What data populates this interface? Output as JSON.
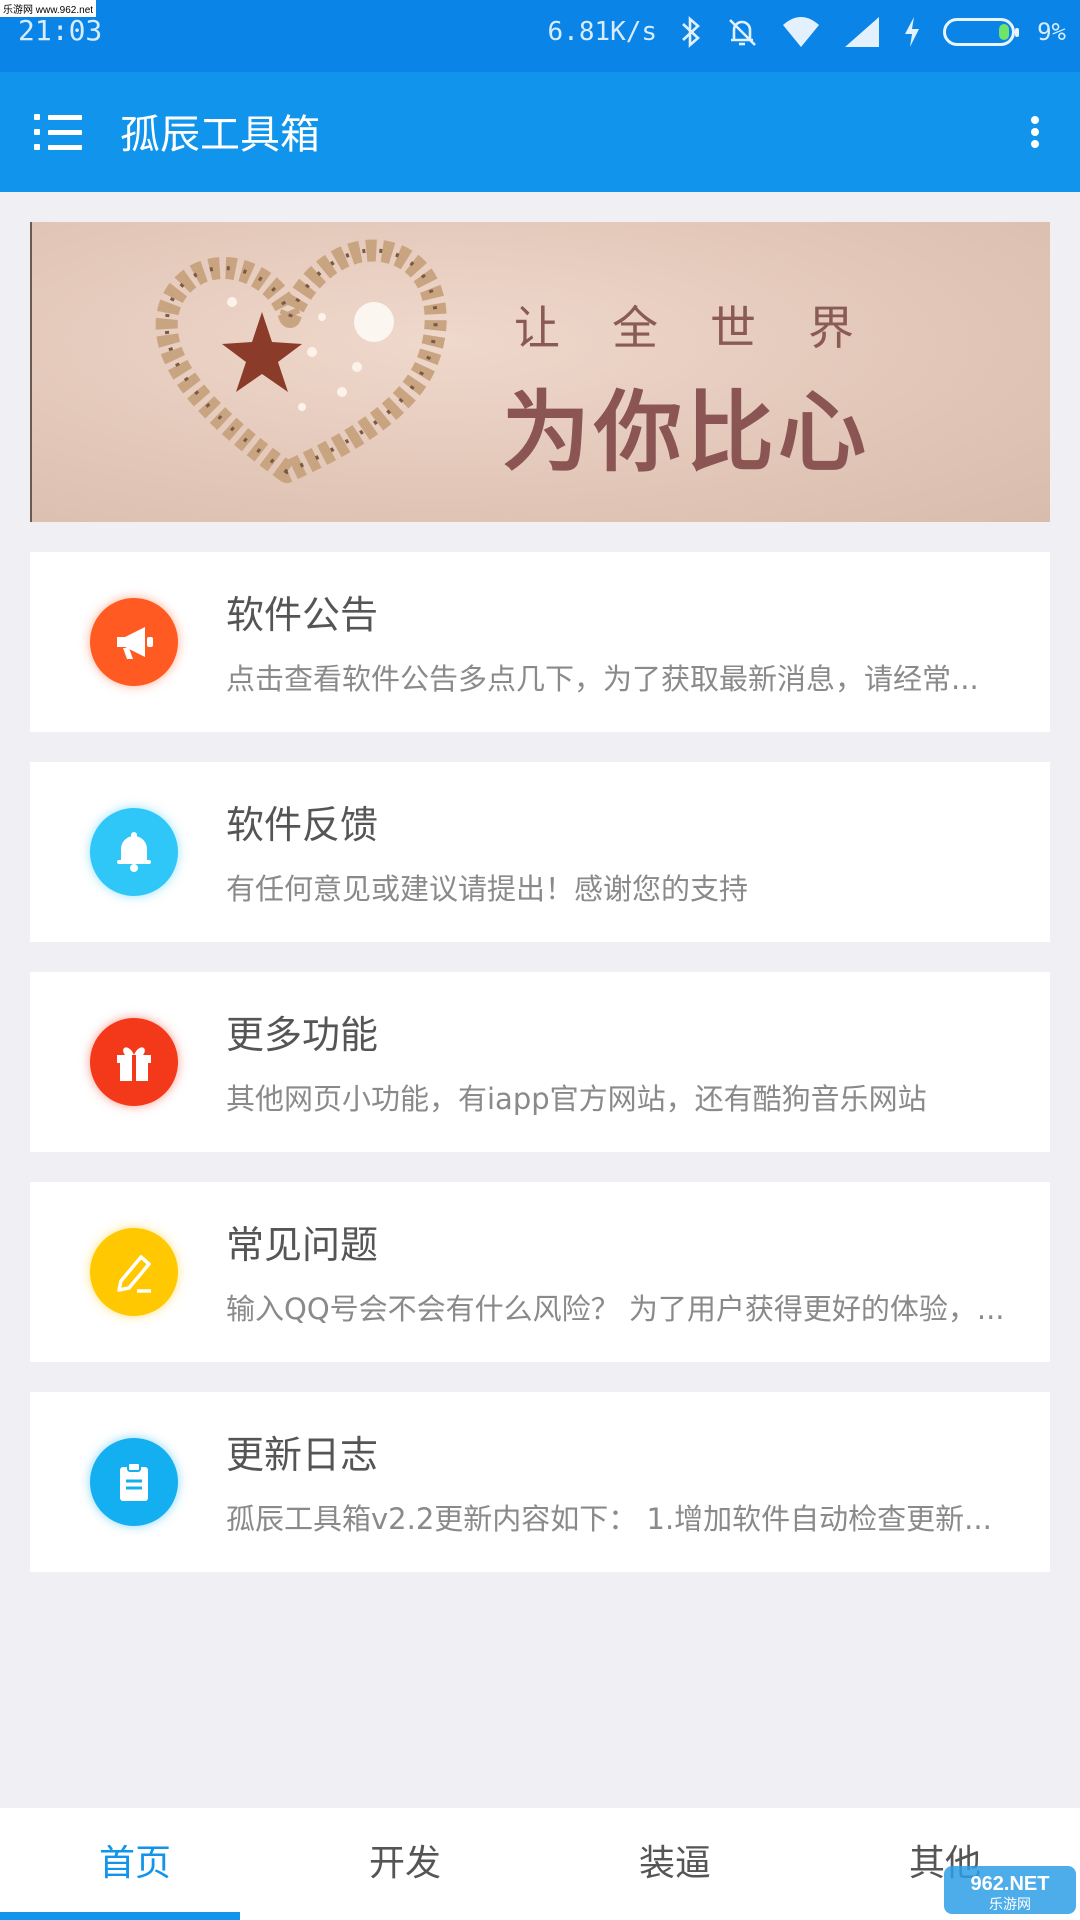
{
  "status_bar": {
    "time": "21:03",
    "watermark": "乐游网 www.962.net",
    "speed": "6.81K/s",
    "battery_pct": "9%",
    "battery_level": 0.09,
    "icons": [
      "bluetooth-icon",
      "bell-muted-icon",
      "wifi-icon",
      "signal-icon",
      "charging-icon",
      "battery-icon"
    ]
  },
  "app_bar": {
    "title": "孤辰工具箱",
    "menu_icon": "menu-icon",
    "more_icon": "more-vert-icon",
    "color": "#1094ec"
  },
  "banner": {
    "line1": "让全世界",
    "line2": "为你比心"
  },
  "cards": [
    {
      "title": "软件公告",
      "desc": "点击查看软件公告多点几下，为了获取最新消息，请经常...",
      "icon": "megaphone-icon",
      "color": "#ff5a22"
    },
    {
      "title": "软件反馈",
      "desc": "有任何意见或建议请提出！感谢您的支持",
      "icon": "bell-icon",
      "color": "#2fc7f7"
    },
    {
      "title": "更多功能",
      "desc": "其他网页小功能，有iapp官方网站，还有酷狗音乐网站",
      "icon": "gift-icon",
      "color": "#f4381a"
    },
    {
      "title": "常见问题",
      "desc": "输入QQ号会不会有什么风险？ 为了用户获得更好的体验，...",
      "icon": "pencil-icon",
      "color": "#ffc800"
    },
    {
      "title": "更新日志",
      "desc": "孤辰工具箱v2.2更新内容如下： 1.增加软件自动检查更新...",
      "icon": "clipboard-icon",
      "color": "#14aff0"
    }
  ],
  "bottom_nav": {
    "tabs": [
      "首页",
      "开发",
      "装逼",
      "其他"
    ],
    "active": 0,
    "corner_logo": "962.NET 乐游网"
  }
}
